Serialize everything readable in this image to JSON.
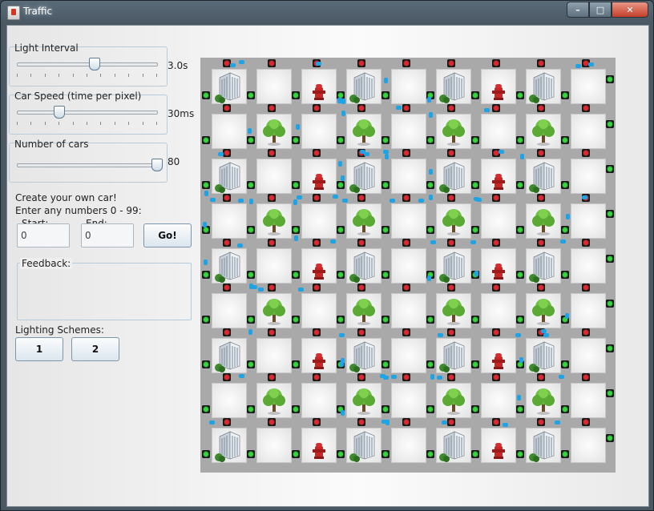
{
  "window": {
    "title": "Traffic",
    "controls": {
      "minimize": "–",
      "maximize": "□",
      "close": "✕"
    }
  },
  "panel": {
    "light_interval": {
      "label": "Light Interval",
      "value": "3.0s",
      "position": 0.55
    },
    "car_speed": {
      "label": "Car Speed (time per pixel)",
      "value": "30ms",
      "position": 0.3
    },
    "num_cars": {
      "label": "Number of cars",
      "value": "80",
      "position": 1.0
    },
    "create_car": {
      "line1": "Create your own car!",
      "line2": "Enter any numbers 0 - 99:",
      "start_label": "Start:",
      "start_value": "0",
      "end_label": "End:",
      "end_value": "0",
      "go_button": "Go!"
    },
    "feedback": {
      "label": "Feedback:"
    },
    "lighting": {
      "label": "Lighting Schemes:",
      "buttons": [
        "1",
        "2"
      ]
    }
  },
  "map": {
    "grid_size": 9,
    "building_pattern": [
      [
        "office",
        "blank",
        "hydrant",
        "office",
        "blank",
        "office",
        "hydrant",
        "office",
        "blank"
      ],
      [
        "blank",
        "tree",
        "blank",
        "tree",
        "blank",
        "tree",
        "blank",
        "tree",
        "blank"
      ]
    ],
    "icons": [
      "office-building-icon",
      "tree-icon",
      "fire-hydrant-icon",
      "traffic-light-red",
      "traffic-light-green",
      "car-icon"
    ]
  }
}
